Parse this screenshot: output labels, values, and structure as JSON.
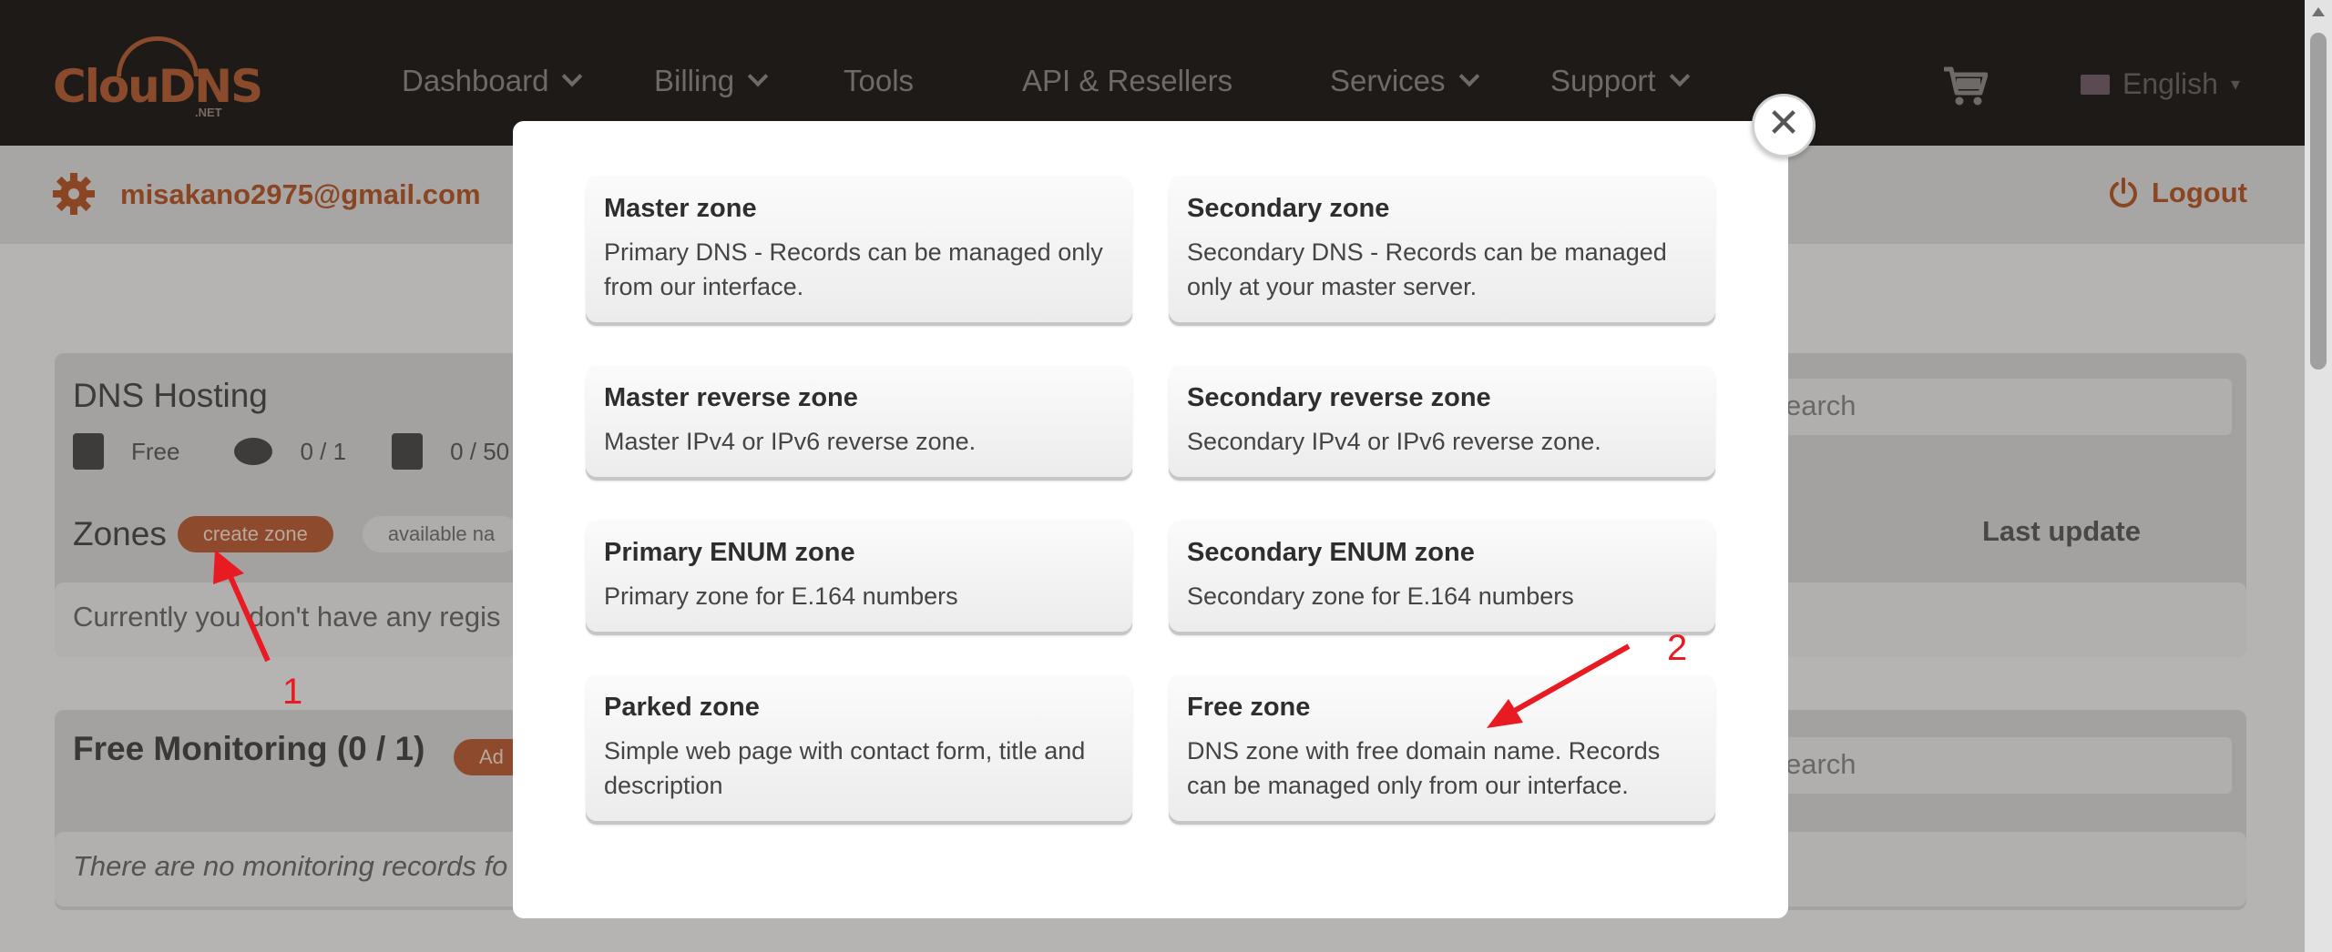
{
  "header": {
    "logo_text": "ClouDNS",
    "logo_suffix": ".NET",
    "nav": [
      {
        "label": "Dashboard",
        "has_dropdown": true
      },
      {
        "label": "Billing",
        "has_dropdown": true
      },
      {
        "label": "Tools",
        "has_dropdown": false
      },
      {
        "label": "API & Resellers",
        "has_dropdown": false
      },
      {
        "label": "Services",
        "has_dropdown": true
      },
      {
        "label": "Support",
        "has_dropdown": true
      }
    ],
    "cart_icon": "cart-icon",
    "language": "English"
  },
  "userbar": {
    "email": "misakano2975@gmail.com",
    "logout_label": "Logout"
  },
  "dns_panel": {
    "title": "DNS Hosting",
    "plan": "Free",
    "zones_count": "0 / 1",
    "records_count": "0 / 50",
    "zones_label": "Zones",
    "create_zone_label": "create zone",
    "available_label": "available na",
    "search_placeholder": "earch",
    "last_update_label": "Last update",
    "empty_text": "Currently you don't have any regis"
  },
  "monitoring_panel": {
    "title": "Free Monitoring (0 / 1)",
    "add_label": "Ad",
    "search_placeholder": "earch",
    "empty_text": "There are no monitoring records fo"
  },
  "annotations": {
    "step1": "1",
    "step2": "2",
    "color": "#e81b23"
  },
  "modal": {
    "zone_types": [
      {
        "title": "Master zone",
        "desc": "Primary DNS - Records can be managed only from our interface."
      },
      {
        "title": "Secondary zone",
        "desc": "Secondary DNS - Records can be managed only at your master server."
      },
      {
        "title": "Master reverse zone",
        "desc": "Master IPv4 or IPv6 reverse zone."
      },
      {
        "title": "Secondary reverse zone",
        "desc": "Secondary IPv4 or IPv6 reverse zone."
      },
      {
        "title": "Primary ENUM zone",
        "desc": "Primary zone for E.164 numbers"
      },
      {
        "title": "Secondary ENUM zone",
        "desc": "Secondary zone for E.164 numbers"
      },
      {
        "title": "Parked zone",
        "desc": "Simple web page with contact form, title and description"
      },
      {
        "title": "Free zone",
        "desc": "DNS zone with free domain name. Records can be managed only from our interface."
      }
    ],
    "close_icon": "close-icon"
  },
  "colors": {
    "accent": "#8a4523",
    "nav_bg": "#1e1a18",
    "annotation": "#e81b23"
  }
}
